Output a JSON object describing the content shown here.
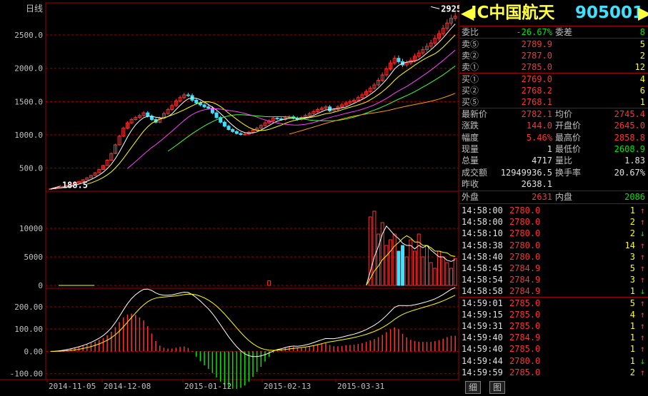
{
  "window": {
    "kline_label": "日线"
  },
  "security": {
    "code_title": "IC中国航天",
    "number": "905001"
  },
  "price_chart": {
    "y_ticks": [
      "2500.0",
      "2000.0",
      "1500.0",
      "1000.0",
      "500.0"
    ],
    "y_tick_values": [
      2500,
      2000,
      1500,
      1000,
      500
    ],
    "ylim": [
      185,
      2940
    ],
    "high_label": "2925",
    "low_label": "188.5",
    "high_value": 2925,
    "low_value": 188.5,
    "close": [
      189,
      200,
      212,
      225,
      240,
      258,
      278,
      300,
      325,
      355,
      390,
      430,
      480,
      540,
      620,
      720,
      850,
      980,
      1100,
      1180,
      1230,
      1260,
      1290,
      1330,
      1280,
      1230,
      1190,
      1250,
      1320,
      1380,
      1440,
      1510,
      1560,
      1600,
      1590,
      1520,
      1480,
      1450,
      1420,
      1400,
      1330,
      1260,
      1190,
      1130,
      1080,
      1050,
      1020,
      1005,
      1010,
      1040,
      1070,
      1100,
      1140,
      1180,
      1210,
      1250,
      1240,
      1230,
      1260,
      1270,
      1250,
      1230,
      1260,
      1290,
      1320,
      1350,
      1380,
      1400,
      1420,
      1360,
      1380,
      1420,
      1450,
      1480,
      1500,
      1520,
      1560,
      1600,
      1650,
      1700,
      1750,
      1820,
      1900,
      1990,
      2080,
      2150,
      2100,
      2050,
      2080,
      2120,
      2180,
      2230,
      2280,
      2330,
      2380,
      2450,
      2520,
      2600,
      2680,
      2750,
      2782
    ]
  },
  "volume_chart": {
    "y_ticks": [
      "10000",
      "5000",
      "0"
    ],
    "y_tick_values": [
      10000,
      5000,
      0
    ],
    "ylim": [
      0,
      16000
    ],
    "values": [
      0,
      0,
      0,
      0,
      0,
      0,
      0,
      0,
      0,
      0,
      0,
      0,
      0,
      0,
      0,
      0,
      0,
      0,
      0,
      0,
      0,
      0,
      0,
      0,
      0,
      0,
      0,
      0,
      0,
      0,
      0,
      0,
      0,
      0,
      0,
      0,
      0,
      0,
      0,
      0,
      0,
      0,
      0,
      0,
      0,
      0,
      0,
      0,
      0,
      0,
      0,
      0,
      0,
      0,
      800,
      0,
      0,
      0,
      0,
      0,
      0,
      0,
      0,
      0,
      0,
      0,
      0,
      0,
      0,
      0,
      0,
      0,
      0,
      0,
      0,
      0,
      0,
      0,
      0,
      12000,
      13000,
      9000,
      11000,
      7000,
      8000,
      9000,
      6000,
      7000,
      5000,
      8000,
      6000,
      9000,
      5000,
      7000,
      4000,
      3000,
      6000,
      5000,
      4000,
      3000,
      4717
    ]
  },
  "macd_chart": {
    "y_ticks": [
      "200.00",
      "100.00",
      "0.00",
      "-100.00"
    ],
    "y_tick_values": [
      200,
      100,
      0,
      -100
    ],
    "ylim": [
      -120,
      270
    ]
  },
  "dates": [
    "2014-11-05",
    "2014-12-08",
    "2015-01-12",
    "2015-02-13",
    "2015-03-31"
  ],
  "quote": {
    "weibi_label": "委比",
    "weibi_value": "-26.67%",
    "weicha_label": "委差",
    "weicha_value": "8",
    "sell": [
      {
        "label": "卖⑤",
        "price": "2789.9",
        "vol": "5"
      },
      {
        "label": "卖②",
        "price": "2787.0",
        "vol": "2"
      },
      {
        "label": "卖①",
        "price": "2785.0",
        "vol": "12"
      }
    ],
    "buy": [
      {
        "label": "买①",
        "price": "2769.0",
        "vol": "4"
      },
      {
        "label": "买②",
        "price": "2768.2",
        "vol": "6"
      },
      {
        "label": "买⑤",
        "price": "2768.1",
        "vol": "1"
      }
    ],
    "stats": [
      {
        "l1": "最新价",
        "v1": "2782.1",
        "c1": "red",
        "l2": "均价",
        "v2": "2745.4",
        "c2": "red"
      },
      {
        "l1": "涨跌",
        "v1": "144.0",
        "c1": "red",
        "l2": "开盘价",
        "v2": "2645.0",
        "c2": "red"
      },
      {
        "l1": "幅度",
        "v1": "5.46%",
        "c1": "red",
        "l2": "最高价",
        "v2": "2858.8",
        "c2": "red"
      },
      {
        "l1": "现量",
        "v1": "1",
        "c1": "wht",
        "l2": "最低价",
        "v2": "2608.9",
        "c2": "grn"
      },
      {
        "l1": "总量",
        "v1": "4717",
        "c1": "wht",
        "l2": "量比",
        "v2": "1.83",
        "c2": "wht"
      },
      {
        "l1": "成交额",
        "v1": "12949936.5",
        "c1": "wht",
        "l2": "换手率",
        "v2": "20.67%",
        "c2": "wht"
      }
    ],
    "zuoshou_label": "昨收",
    "zuoshou_value": "2638.1",
    "waipan_label": "外盘",
    "waipan_value": "2631",
    "neipan_label": "内盘",
    "neipan_value": "2086"
  },
  "ticks": [
    {
      "time": "14:58:00",
      "price": "2780.0",
      "vol": "1",
      "dir": "up"
    },
    {
      "time": "14:58:00",
      "price": "2780.0",
      "vol": "2",
      "dir": "up"
    },
    {
      "time": "14:58:10",
      "price": "2780.0",
      "vol": "2",
      "dir": "down"
    },
    {
      "time": "14:58:38",
      "price": "2780.0",
      "vol": "14",
      "dir": "up"
    },
    {
      "time": "14:58:40",
      "price": "2780.0",
      "vol": "3",
      "dir": "up"
    },
    {
      "time": "14:58:45",
      "price": "2784.9",
      "vol": "5",
      "dir": "up"
    },
    {
      "time": "14:58:54",
      "price": "2784.9",
      "vol": "3",
      "dir": "up"
    },
    {
      "time": "14:58:58",
      "price": "2784.9",
      "vol": "1",
      "dir": "down"
    },
    {
      "time": "14:59:01",
      "price": "2785.0",
      "vol": "5",
      "dir": "up"
    },
    {
      "time": "14:59:15",
      "price": "2785.0",
      "vol": "4",
      "dir": "up"
    },
    {
      "time": "14:59:31",
      "price": "2785.0",
      "vol": "1",
      "dir": "up"
    },
    {
      "time": "14:59:40",
      "price": "2784.9",
      "vol": "1",
      "dir": "up"
    },
    {
      "time": "14:59:40",
      "price": "2785.0",
      "vol": "1",
      "dir": "up"
    },
    {
      "time": "14:59:44",
      "price": "2780.0",
      "vol": "1",
      "dir": "down"
    },
    {
      "time": "14:59:59",
      "price": "2785.0",
      "vol": "2",
      "dir": "up"
    }
  ],
  "tabs": {
    "detail": "细",
    "chart": "图"
  },
  "colors": {
    "up": "#ff3232",
    "down": "#00e600",
    "grid": "#a00000",
    "volume_up": "#40e0ff"
  }
}
